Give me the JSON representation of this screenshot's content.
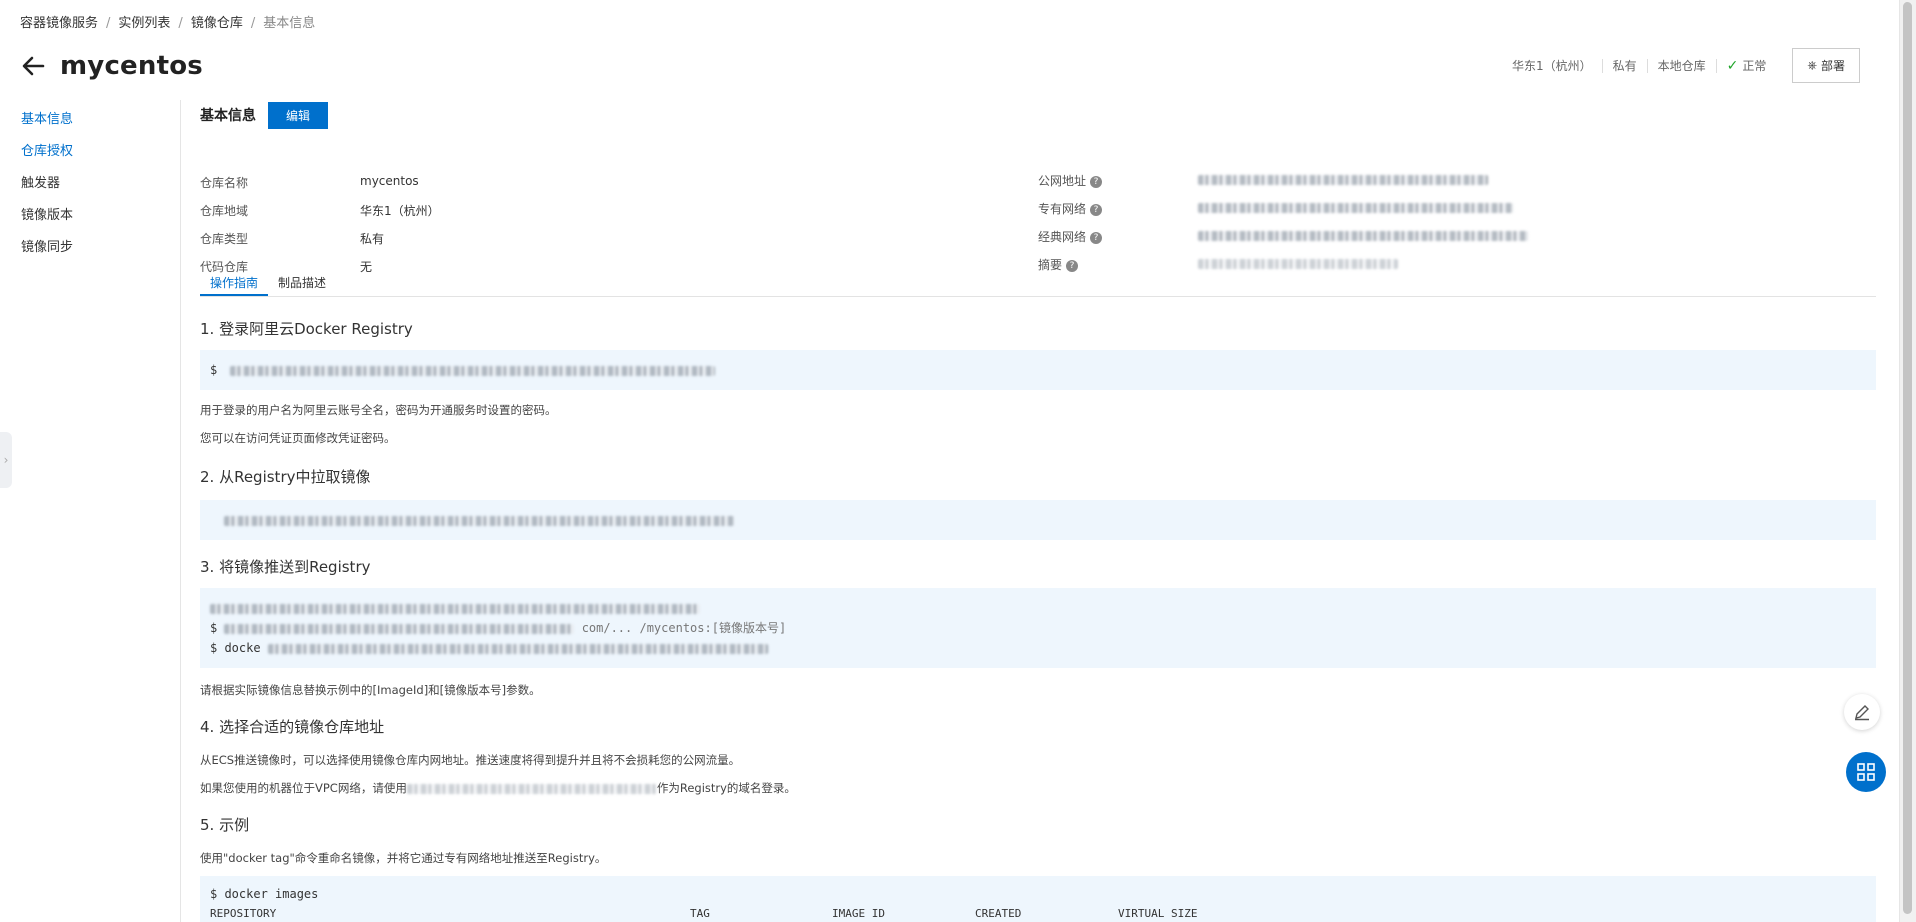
{
  "breadcrumb": [
    "容器镜像服务",
    "实例列表",
    "镜像仓库",
    "基本信息"
  ],
  "header": {
    "title": "mycentos",
    "status": {
      "region": "华东1（杭州）",
      "visibility": "私有",
      "type": "本地仓库",
      "state": "正常",
      "deploy_label": "部署"
    }
  },
  "sidebar": {
    "items": [
      {
        "label": "基本信息"
      },
      {
        "label": "仓库授权"
      },
      {
        "label": "触发器"
      },
      {
        "label": "镜像版本"
      },
      {
        "label": "镜像同步"
      }
    ]
  },
  "basic_info": {
    "label": "基本信息",
    "edit_label": "编辑",
    "left_fields": [
      {
        "key": "仓库名称",
        "value": "mycentos"
      },
      {
        "key": "仓库地域",
        "value": "华东1（杭州）"
      },
      {
        "key": "仓库类型",
        "value": "私有"
      },
      {
        "key": "代码仓库",
        "value": "无"
      }
    ],
    "right_fields": [
      {
        "key": "公网地址",
        "value": ""
      },
      {
        "key": "专有网络",
        "value": ""
      },
      {
        "key": "经典网络",
        "value": ""
      },
      {
        "key": "摘要",
        "value": ""
      }
    ]
  },
  "tabs": [
    {
      "label": "操作指南"
    },
    {
      "label": "制品描述"
    }
  ],
  "guide": {
    "step1_title": "1. 登录阿里云Docker Registry",
    "step1_code_prefix": "$",
    "step1_note1": "用于登录的用户名为阿里云账号全名，密码为开通服务时设置的密码。",
    "step1_note2": "您可以在访问凭证页面修改凭证密码。",
    "step2_title": "2. 从Registry中拉取镜像",
    "step3_title": "3. 将镜像推送到Registry",
    "step3_line2_suffix": "com/... /mycentos:[镜像版本号]",
    "step3_line3_prefix": "$ docke",
    "step3_note": "请根据实际镜像信息替换示例中的[ImageId]和[镜像版本号]参数。",
    "step4_title": "4. 选择合适的镜像仓库地址",
    "step4_note1": "从ECS推送镜像时，可以选择使用镜像仓库内网地址。推送速度将得到提升并且将不会损耗您的公网流量。",
    "step4_note2_prefix": "如果您使用的机器位于VPC网络，请使用",
    "step4_note2_suffix": "作为Registry的域名登录。",
    "step5_title": "5. 示例",
    "step5_note": "使用\"docker tag\"命令重命名镜像，并将它通过专有网络地址推送至Registry。",
    "step5_code_line1": "$ docker images",
    "step5_code_headers": [
      "REPOSITORY",
      "TAG",
      "IMAGE ID",
      "CREATED",
      "VIRTUAL SIZE"
    ]
  }
}
